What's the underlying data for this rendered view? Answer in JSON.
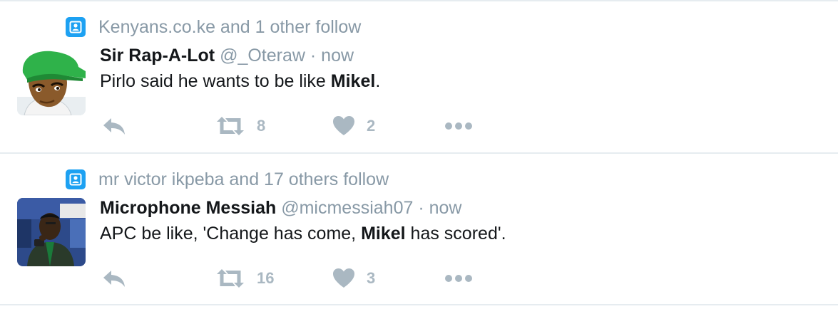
{
  "tweets": [
    {
      "context": {
        "icon": "person-icon",
        "text": "Kenyans.co.ke and 1 other follow"
      },
      "author": {
        "fullname": "Sir Rap-A-Lot",
        "username": "@_Oteraw",
        "separator": "·",
        "time": "now"
      },
      "text": {
        "before": "Pirlo said he wants to be like ",
        "bold": "Mikel",
        "after": "."
      },
      "actions": {
        "reply_icon": "reply-icon",
        "retweet_icon": "retweet-icon",
        "retweet_count": "8",
        "like_icon": "heart-icon",
        "like_count": "2",
        "more_icon": "more-icon"
      }
    },
    {
      "context": {
        "icon": "person-icon",
        "text": "mr victor ikpeba and 17 others follow"
      },
      "author": {
        "fullname": "Microphone Messiah",
        "username": "@micmessiah07",
        "separator": "·",
        "time": "now"
      },
      "text": {
        "before": "APC be like, 'Change has come, ",
        "bold": "Mikel",
        "after": " has scored'."
      },
      "actions": {
        "reply_icon": "reply-icon",
        "retweet_icon": "retweet-icon",
        "retweet_count": "16",
        "like_icon": "heart-icon",
        "like_count": "3",
        "more_icon": "more-icon"
      }
    }
  ],
  "colors": {
    "accent": "#1da1f2",
    "muted": "#8899a6",
    "action": "#aab8c2",
    "divider": "#e6ecf0",
    "text": "#14171a"
  }
}
